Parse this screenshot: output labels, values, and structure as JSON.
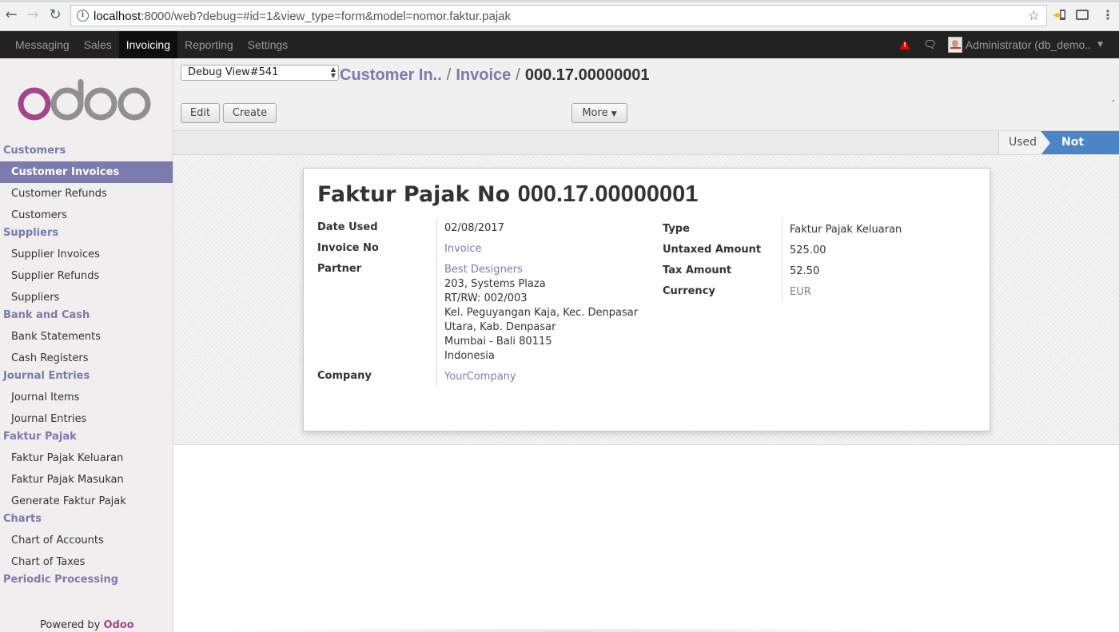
{
  "browser": {
    "url_host": "localhost",
    "url_rest": ":8000/web?debug=#id=1&view_type=form&model=nomor.faktur.pajak"
  },
  "topbar": {
    "menus": [
      {
        "label": "Messaging",
        "active": false
      },
      {
        "label": "Sales",
        "active": false
      },
      {
        "label": "Invoicing",
        "active": true
      },
      {
        "label": "Reporting",
        "active": false
      },
      {
        "label": "Settings",
        "active": false
      }
    ],
    "user": "Administrator (db_demo..",
    "icons": [
      "warning-icon",
      "chat-icon"
    ]
  },
  "sidebar": {
    "sections": [
      {
        "title": "Customers",
        "items": [
          {
            "label": "Customer Invoices",
            "active": true
          },
          {
            "label": "Customer Refunds",
            "active": false
          },
          {
            "label": "Customers",
            "active": false
          }
        ]
      },
      {
        "title": "Suppliers",
        "items": [
          {
            "label": "Supplier Invoices",
            "active": false
          },
          {
            "label": "Supplier Refunds",
            "active": false
          },
          {
            "label": "Suppliers",
            "active": false
          }
        ]
      },
      {
        "title": "Bank and Cash",
        "items": [
          {
            "label": "Bank Statements",
            "active": false
          },
          {
            "label": "Cash Registers",
            "active": false
          }
        ]
      },
      {
        "title": "Journal Entries",
        "items": [
          {
            "label": "Journal Items",
            "active": false
          },
          {
            "label": "Journal Entries",
            "active": false
          }
        ]
      },
      {
        "title": "Faktur Pajak",
        "items": [
          {
            "label": "Faktur Pajak Keluaran",
            "active": false
          },
          {
            "label": "Faktur Pajak Masukan",
            "active": false
          },
          {
            "label": "Generate Faktur Pajak",
            "active": false
          }
        ]
      },
      {
        "title": "Charts",
        "items": [
          {
            "label": "Chart of Accounts",
            "active": false
          },
          {
            "label": "Chart of Taxes",
            "active": false
          }
        ]
      },
      {
        "title": "Periodic Processing",
        "items": []
      }
    ],
    "powered_by": "Powered by",
    "powered_brand": "Odoo"
  },
  "header": {
    "debug_select": "Debug View#541",
    "breadcrumb": [
      {
        "label": "Customer In.."
      },
      {
        "label": "Invoice"
      }
    ],
    "breadcrumb_current": "000.17.00000001",
    "buttons": {
      "edit": "Edit",
      "create": "Create",
      "more": "More"
    }
  },
  "status": {
    "used": "Used",
    "not_used": "Not Used",
    "active": "Not Used"
  },
  "form": {
    "title_prefix": "Faktur Pajak No",
    "title_number": "000.17.00000001",
    "left": {
      "date_used_label": "Date Used",
      "date_used": "02/08/2017",
      "invoice_no_label": "Invoice No",
      "invoice_no": "Invoice",
      "partner_label": "Partner",
      "partner_name": "Best Designers",
      "partner_address": [
        "203, Systems Plaza",
        "RT/RW: 002/003",
        "Kel. Peguyangan Kaja, Kec. Denpasar",
        "Utara, Kab. Denpasar",
        "Mumbai - Bali 80115",
        "Indonesia"
      ],
      "company_label": "Company",
      "company": "YourCompany"
    },
    "right": {
      "type_label": "Type",
      "type": "Faktur Pajak Keluaran",
      "untaxed_label": "Untaxed Amount",
      "untaxed": "525.00",
      "tax_label": "Tax Amount",
      "tax": "52.50",
      "currency_label": "Currency",
      "currency": "EUR"
    }
  }
}
